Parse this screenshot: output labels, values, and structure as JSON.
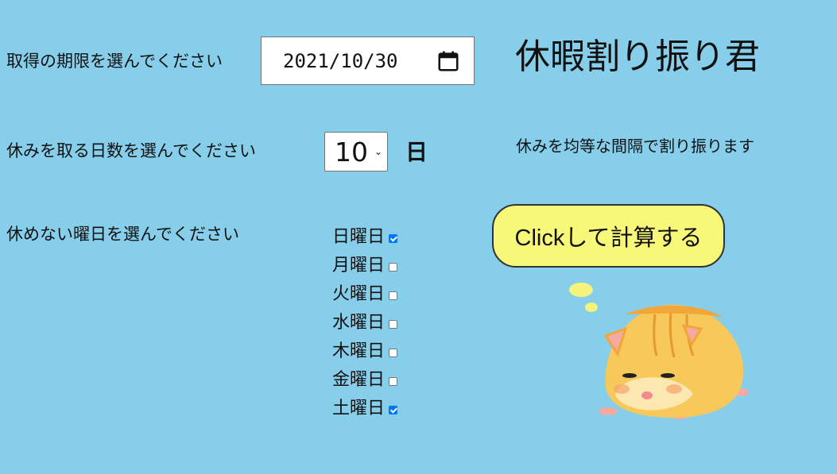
{
  "form": {
    "deadline_label": "取得の期限を選んでください",
    "deadline_value": "2021/10/30",
    "days_label": "休みを取る日数を選んでください",
    "days_value": "10",
    "days_unit": "日",
    "weekdays_label": "休めない曜日を選んでください",
    "weekdays": [
      {
        "label": "日曜日",
        "checked": true
      },
      {
        "label": "月曜日",
        "checked": false
      },
      {
        "label": "火曜日",
        "checked": false
      },
      {
        "label": "水曜日",
        "checked": false
      },
      {
        "label": "木曜日",
        "checked": false
      },
      {
        "label": "金曜日",
        "checked": false
      },
      {
        "label": "土曜日",
        "checked": true
      }
    ]
  },
  "header": {
    "title": "休暇割り振り君",
    "subtitle": "休みを均等な間隔で割り振ります"
  },
  "action": {
    "button_label": "Clickして計算する"
  },
  "icons": {
    "calendar": "calendar-icon",
    "select": "chevron-down-icon",
    "mascot": "hamster-illustration"
  },
  "colors": {
    "background": "#87CEEB",
    "button": "#F7F77A",
    "checkbox_checked": "#0075FF",
    "hamster": "#F7C85A"
  }
}
